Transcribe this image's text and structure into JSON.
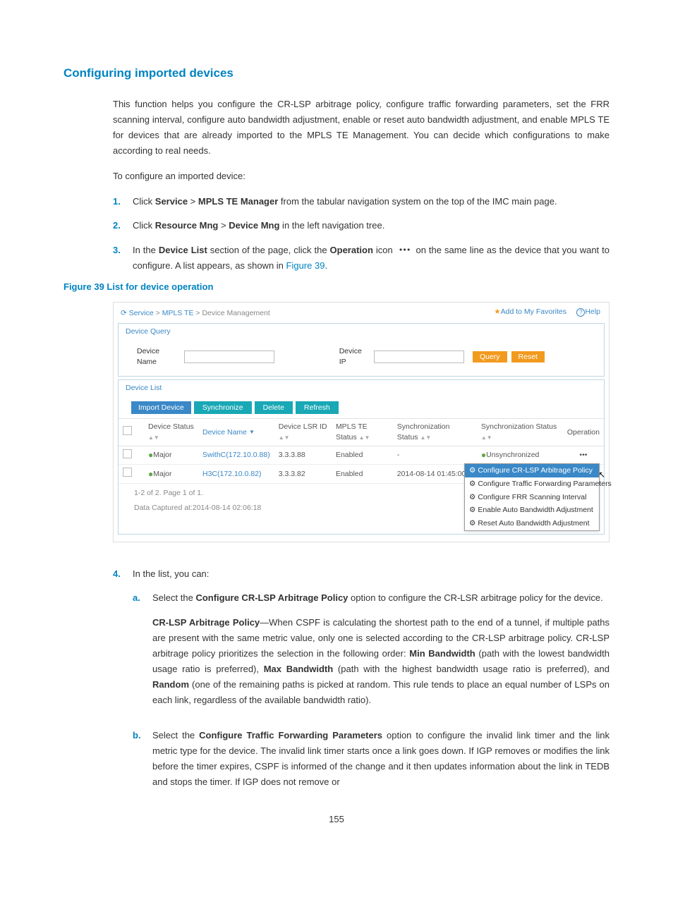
{
  "title": "Configuring imported devices",
  "intro": "This function helps you configure the CR-LSP arbitrage policy, configure traffic forwarding parameters, set the FRR scanning interval, configure auto bandwidth adjustment, enable or reset auto bandwidth adjustment, and enable MPLS TE for devices that are already imported to the MPLS TE Management. You can decide which configurations to make according to real needs.",
  "intro2": "To configure an imported device:",
  "steps": {
    "s1_a": "Click ",
    "s1_b": "Service",
    "s1_c": " > ",
    "s1_d": "MPLS TE Manager",
    "s1_e": " from the tabular navigation system on the top of the IMC main page.",
    "s2_a": "Click ",
    "s2_b": "Resource Mng",
    "s2_c": " > ",
    "s2_d": "Device Mng",
    "s2_e": " in the left navigation tree.",
    "s3_a": "In the ",
    "s3_b": "Device List",
    "s3_c": " section of the page, click the ",
    "s3_d": "Operation",
    "s3_e": " icon ",
    "s3_f": " on the same line as the device that you want to configure. A list appears, as shown in ",
    "s3_link": "Figure 39",
    "s3_g": ".",
    "s4": "In the list, you can:"
  },
  "figcap": "Figure 39 List for device operation",
  "bc": {
    "serv": "Service",
    "mpls": "MPLS TE",
    "dm": "Device Management"
  },
  "fav": "Add to My Favorites",
  "help": "Help",
  "dq": "Device Query",
  "dl": "Device List",
  "lblName": "Device Name",
  "lblIP": "Device IP",
  "query": "Query",
  "reset": "Reset",
  "btn": {
    "imp": "Import Device",
    "sync": "Synchronize",
    "del": "Delete",
    "ref": "Refresh"
  },
  "th": {
    "ds": "Device Status",
    "dn": "Device Name",
    "lsr": "Device LSR ID",
    "te": "MPLS TE Status",
    "ss1": "Synchronization Status",
    "ss2": "Synchronization Status",
    "op": "Operation"
  },
  "rows": [
    {
      "status": "Major",
      "name": "SwithC(172.10.0.88)",
      "lsr": "3.3.3.88",
      "te": "Enabled",
      "s1": "-",
      "s2": "Unsynchronized"
    },
    {
      "status": "Major",
      "name": "H3C(172.10.0.82)",
      "lsr": "3.3.3.82",
      "te": "Enabled",
      "s1": "2014-08-14 01:45:00",
      "s2": ""
    }
  ],
  "menu": [
    "Configure CR-LSP Arbitrage Policy",
    "Configure Traffic Forwarding Parameters",
    "Configure FRR Scanning Interval",
    "Enable Auto Bandwidth Adjustment",
    "Reset Auto Bandwidth Adjustment"
  ],
  "pager": "1-2 of 2. Page 1 of 1.",
  "captured": "Data Captured at:2014-08-14 02:06:18",
  "sub": {
    "a1": "Select the ",
    "a2": "Configure CR-LSP Arbitrage Policy",
    "a3": " option to configure the CR-LSR arbitrage policy for the device.",
    "ap1": "CR-LSP Arbitrage Policy",
    "ap2": "—When CSPF is calculating the shortest path to the end of a tunnel, if multiple paths are present with the same metric value, only one is selected according to the CR-LSP arbitrage policy. CR-LSP arbitrage policy prioritizes the selection in the following order: ",
    "ap3": "Min Bandwidth",
    "ap4": " (path with the lowest bandwidth usage ratio is preferred), ",
    "ap5": "Max Bandwidth",
    "ap6": " (path with the highest bandwidth usage ratio is preferred), and ",
    "ap7": "Random",
    "ap8": " (one of the remaining paths is picked at random. This rule tends to place an equal number of LSPs on each link, regardless of the available bandwidth ratio).",
    "b1": "Select the ",
    "b2": "Configure Traffic Forwarding Parameters",
    "b3": " option to configure the invalid link timer and the link metric type for the device. The invalid link timer starts once a link goes down. If IGP removes or modifies the link before the timer expires, CSPF is informed of the change and it then updates information about the link in TEDB and stops the timer. If IGP does not remove or"
  },
  "pagenum": "155"
}
